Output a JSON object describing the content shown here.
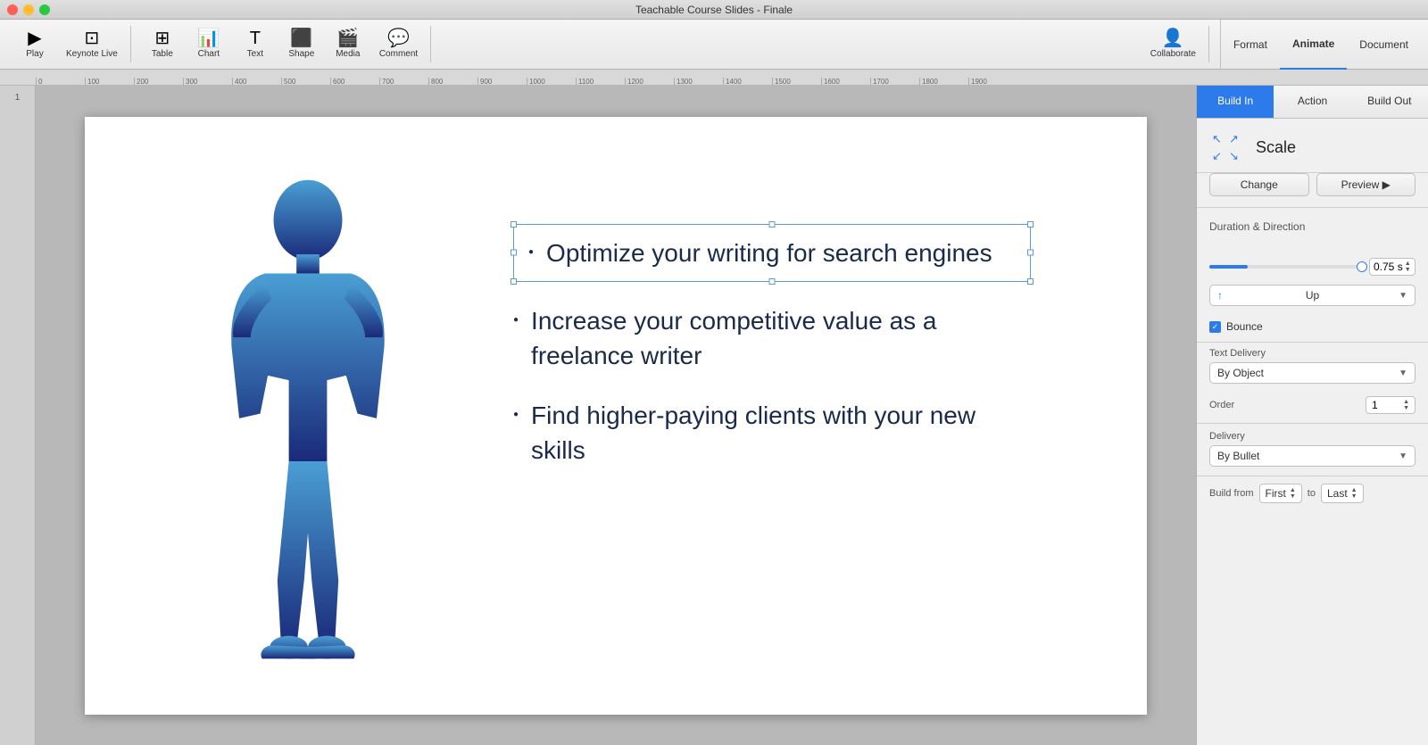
{
  "titleBar": {
    "title": "Teachable Course Slides - Finale"
  },
  "toolbar": {
    "playLabel": "Play",
    "keynoteLiveLabel": "Keynote Live",
    "tableLabel": "Table",
    "chartLabel": "Chart",
    "textLabel": "Text",
    "shapeLabel": "Shape",
    "mediaLabel": "Media",
    "commentLabel": "Comment",
    "collaborateLabel": "Collaborate",
    "formatLabel": "Format",
    "animateLabel": "Animate",
    "documentLabel": "Document"
  },
  "rulerMarks": [
    "0",
    "100",
    "200",
    "300",
    "400",
    "500",
    "600",
    "700",
    "800",
    "900",
    "1000",
    "1100",
    "1200",
    "1300",
    "1400",
    "1500",
    "1600",
    "1700",
    "1800",
    "1900"
  ],
  "rightPanelTabs": {
    "buildIn": "Build In",
    "action": "Action",
    "buildOut": "Build Out"
  },
  "animation": {
    "type": "Scale",
    "changeLabel": "Change",
    "previewLabel": "Preview ▶",
    "durationLabel": "Duration & Direction",
    "durationValue": "0.75 s",
    "directionLabel": "Up",
    "bounceLabel": "Bounce",
    "bounceChecked": true,
    "textDeliveryLabel": "Text Delivery",
    "textDeliveryValue": "By Object",
    "orderLabel": "Order",
    "orderValue": "1",
    "deliveryLabel": "Delivery",
    "deliveryValue": "By Bullet",
    "buildFromLabel": "Build from",
    "buildFromStart": "First",
    "buildFromTo": "to",
    "buildFromEnd": "Last"
  },
  "slide": {
    "bullets": [
      {
        "text": "Optimize your writing for search engines",
        "selected": true
      },
      {
        "text": "Increase your competitive value as a freelance writer",
        "selected": false
      },
      {
        "text": "Find higher-paying clients with your new skills",
        "selected": false
      }
    ]
  },
  "colors": {
    "accent": "#2d7aeb",
    "textDark": "#1a2a4a",
    "silhouetteTop": "#4a9fd4",
    "silhouetteBottom": "#1a2a7a"
  }
}
